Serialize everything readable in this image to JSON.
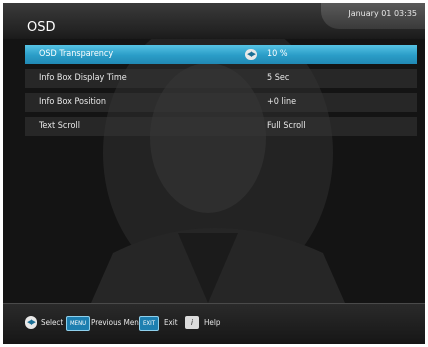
{
  "header": {
    "title": "OSD",
    "clock": "January 01 03:35"
  },
  "menu": {
    "items": [
      {
        "label": "OSD Transparency",
        "value": "10 %",
        "selected": true
      },
      {
        "label": "Info Box Display Time",
        "value": "5 Sec",
        "selected": false
      },
      {
        "label": "Info Box Position",
        "value": "+0 line",
        "selected": false
      },
      {
        "label": "Text Scroll",
        "value": "Full Scroll",
        "selected": false
      }
    ]
  },
  "footer": {
    "select_icon": "left-right-arrows-icon",
    "select_label": "Select",
    "menu_key": "MENU",
    "menu_label": "Previous Menu",
    "exit_key": "EXIT",
    "exit_label": "Exit",
    "info_key": "i",
    "help_label": "Help"
  },
  "colors": {
    "highlight": "#2a9cc7",
    "key_blue": "#1e7fb0",
    "background": "#121212"
  }
}
